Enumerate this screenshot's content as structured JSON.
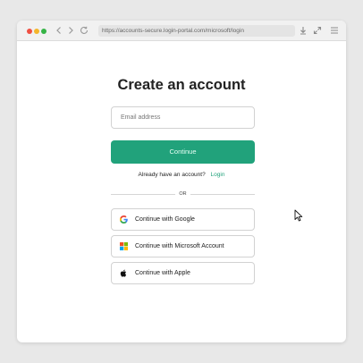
{
  "browser": {
    "url": "https://accounts-secure.login-portal.com/microsoft/login",
    "controls": [
      "back-icon",
      "forward-icon",
      "reload-icon",
      "download-icon",
      "expand-icon",
      "menu-icon"
    ]
  },
  "page": {
    "title": "Create an account",
    "email_placeholder": "Email address",
    "continue_label": "Continue",
    "have_account_text": "Already have an account?",
    "login_link": "Login",
    "divider_text": "OR",
    "social": [
      {
        "label": "Continue with Google",
        "icon": "google-icon"
      },
      {
        "label": "Continue with Microsoft Account",
        "icon": "microsoft-icon"
      },
      {
        "label": "Continue with Apple",
        "icon": "apple-icon"
      }
    ]
  },
  "colors": {
    "accent": "#21a27b",
    "background": "#e8e8e8"
  }
}
